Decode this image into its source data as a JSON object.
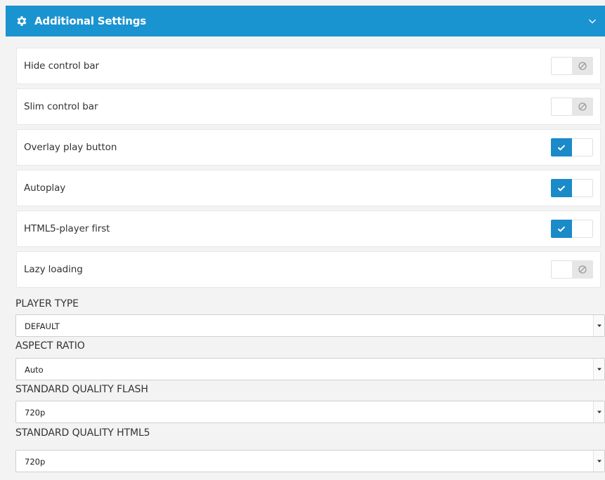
{
  "header": {
    "title": "Additional Settings",
    "icon": "gear-icon",
    "collapse_icon": "chevron-down-icon",
    "accent_color": "#1a93d1"
  },
  "toggles": [
    {
      "label": "Hide control bar",
      "enabled": false
    },
    {
      "label": "Slim control bar",
      "enabled": false
    },
    {
      "label": "Overlay play button",
      "enabled": true
    },
    {
      "label": "Autoplay",
      "enabled": true
    },
    {
      "label": "HTML5-player first",
      "enabled": true
    },
    {
      "label": "Lazy loading",
      "enabled": false
    }
  ],
  "fields": [
    {
      "label": "PLAYER TYPE",
      "value": "DEFAULT"
    },
    {
      "label": "ASPECT RATIO",
      "value": "Auto"
    },
    {
      "label": "STANDARD QUALITY FLASH",
      "value": "720p"
    },
    {
      "label": "STANDARD QUALITY HTML5",
      "value": "720p"
    }
  ]
}
